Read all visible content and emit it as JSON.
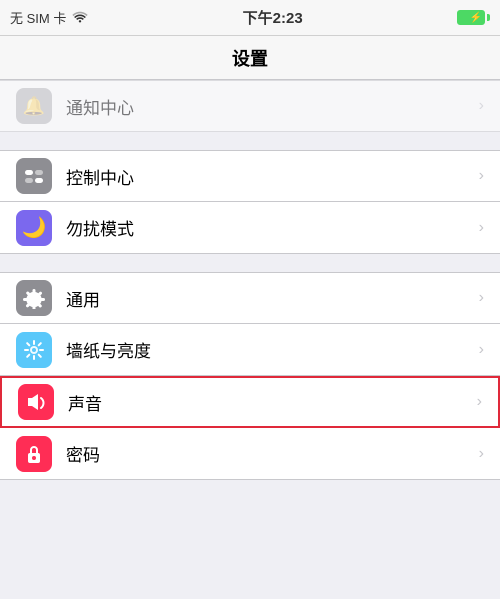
{
  "statusBar": {
    "simText": "无 SIM 卡",
    "wifiText": "WiFi",
    "timeText": "下午2:23",
    "batteryIcon": "⚡"
  },
  "navBar": {
    "title": "设置"
  },
  "sections": [
    {
      "id": "section1",
      "items": [
        {
          "id": "notifications",
          "label": "通知中心",
          "iconColor": "gray",
          "iconSymbol": "🔔",
          "greyed": true
        }
      ]
    },
    {
      "id": "section2",
      "items": [
        {
          "id": "control-center",
          "label": "控制中心",
          "iconColor": "gray",
          "iconSymbol": "toggle"
        },
        {
          "id": "do-not-disturb",
          "label": "勿扰模式",
          "iconColor": "purple",
          "iconSymbol": "moon"
        }
      ]
    },
    {
      "id": "section3",
      "items": [
        {
          "id": "general",
          "label": "通用",
          "iconColor": "gray",
          "iconSymbol": "gear"
        },
        {
          "id": "wallpaper",
          "label": "墙纸与亮度",
          "iconColor": "teal",
          "iconSymbol": "flower"
        },
        {
          "id": "sound",
          "label": "声音",
          "iconColor": "pink",
          "iconSymbol": "sound",
          "highlighted": true
        },
        {
          "id": "passcode",
          "label": "密码",
          "iconColor": "pink",
          "iconSymbol": "lock"
        }
      ]
    }
  ],
  "chevron": "›"
}
